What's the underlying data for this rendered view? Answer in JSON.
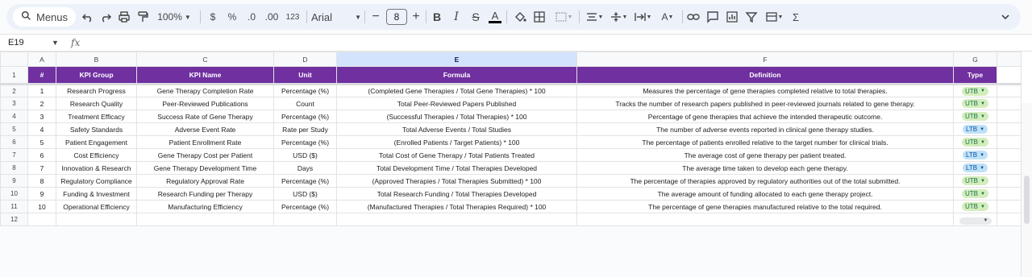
{
  "toolbar": {
    "menus_label": "Menus",
    "zoom": "100%",
    "currency": "$",
    "percent": "%",
    "dec_decrease": ".0",
    "dec_increase": ".00",
    "format_123": "123",
    "font": "Arial",
    "font_size": "8"
  },
  "formula_bar": {
    "cell_ref": "E19",
    "fx": "fx",
    "content": ""
  },
  "columns": [
    "A",
    "B",
    "C",
    "D",
    "E",
    "F",
    "G"
  ],
  "selected_column": "E",
  "header": {
    "row_num": "1",
    "cells": [
      "#",
      "KPI Group",
      "KPI Name",
      "Unit",
      "Formula",
      "Definition",
      "Type"
    ]
  },
  "rows": [
    {
      "n": "2",
      "num": "1",
      "group": "Research Progress",
      "name": "Gene Therapy Completion Rate",
      "unit": "Percentage (%)",
      "formula": "(Completed Gene Therapies / Total Gene Therapies) * 100",
      "definition": "Measures the percentage of gene therapies completed relative to total therapies.",
      "type": "UTB"
    },
    {
      "n": "3",
      "num": "2",
      "group": "Research Quality",
      "name": "Peer-Reviewed Publications",
      "unit": "Count",
      "formula": "Total Peer-Reviewed Papers Published",
      "definition": "Tracks the number of research papers published in peer-reviewed journals related to gene therapy.",
      "type": "UTB"
    },
    {
      "n": "4",
      "num": "3",
      "group": "Treatment Efficacy",
      "name": "Success Rate of Gene Therapy",
      "unit": "Percentage (%)",
      "formula": "(Successful Therapies / Total Therapies) * 100",
      "definition": "Percentage of gene therapies that achieve the intended therapeutic outcome.",
      "type": "UTB"
    },
    {
      "n": "5",
      "num": "4",
      "group": "Safety Standards",
      "name": "Adverse Event Rate",
      "unit": "Rate per Study",
      "formula": "Total Adverse Events / Total Studies",
      "definition": "The number of adverse events reported in clinical gene therapy studies.",
      "type": "LTB"
    },
    {
      "n": "6",
      "num": "5",
      "group": "Patient Engagement",
      "name": "Patient Enrollment Rate",
      "unit": "Percentage (%)",
      "formula": "(Enrolled Patients / Target Patients) * 100",
      "definition": "The percentage of patients enrolled relative to the target number for clinical trials.",
      "type": "UTB"
    },
    {
      "n": "7",
      "num": "6",
      "group": "Cost Efficiency",
      "name": "Gene Therapy Cost per Patient",
      "unit": "USD ($)",
      "formula": "Total Cost of Gene Therapy / Total Patients Treated",
      "definition": "The average cost of gene therapy per patient treated.",
      "type": "LTB"
    },
    {
      "n": "8",
      "num": "7",
      "group": "Innovation & Research",
      "name": "Gene Therapy Development Time",
      "unit": "Days",
      "formula": "Total Development Time / Total Therapies Developed",
      "definition": "The average time taken to develop each gene therapy.",
      "type": "LTB"
    },
    {
      "n": "9",
      "num": "8",
      "group": "Regulatory Compliance",
      "name": "Regulatory Approval Rate",
      "unit": "Percentage (%)",
      "formula": "(Approved Therapies / Total Therapies Submitted) * 100",
      "definition": "The percentage of therapies approved by regulatory authorities out of the total submitted.",
      "type": "UTB"
    },
    {
      "n": "10",
      "num": "9",
      "group": "Funding & Investment",
      "name": "Research Funding per Therapy",
      "unit": "USD ($)",
      "formula": "Total Research Funding / Total Therapies Developed",
      "definition": "The average amount of funding allocated to each gene therapy project.",
      "type": "UTB"
    },
    {
      "n": "11",
      "num": "10",
      "group": "Operational Efficiency",
      "name": "Manufacturing Efficiency",
      "unit": "Percentage (%)",
      "formula": "(Manufactured Therapies / Total Therapies Required) * 100",
      "definition": "The percentage of gene therapies manufactured relative to the total required.",
      "type": "UTB"
    }
  ],
  "empty_row": {
    "n": "12"
  }
}
